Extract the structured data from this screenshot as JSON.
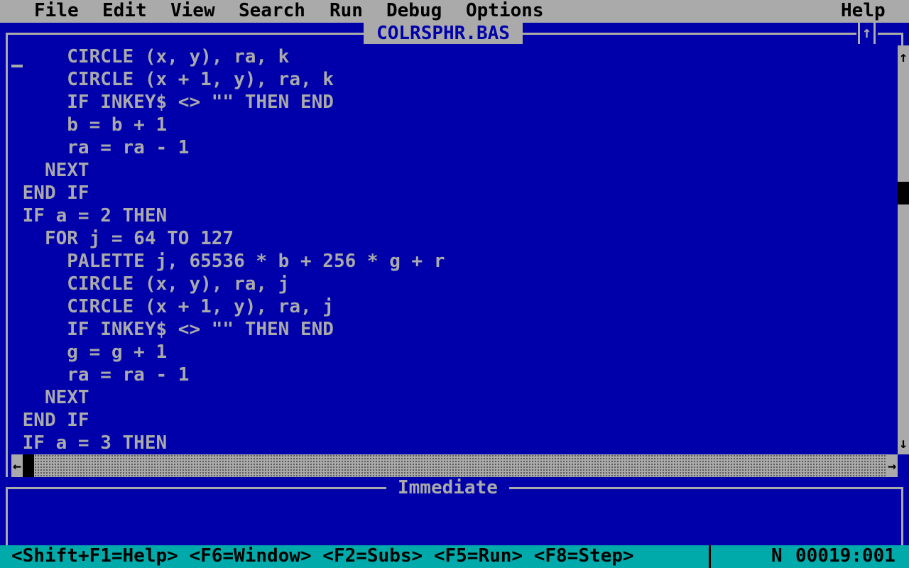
{
  "menu": {
    "file": "File",
    "edit": "Edit",
    "view": "View",
    "search": "Search",
    "run": "Run",
    "debug": "Debug",
    "options": "Options",
    "help": "Help"
  },
  "editor": {
    "title": "COLRSPHR.BAS",
    "maximize_icon": "↑",
    "lines": [
      "     CIRCLE (x, y), ra, k",
      "     CIRCLE (x + 1, y), ra, k",
      "     IF INKEY$ <> \"\" THEN END",
      "     b = b + 1",
      "     ra = ra - 1",
      "   NEXT",
      " END IF",
      " IF a = 2 THEN",
      "   FOR j = 64 TO 127",
      "     PALETTE j, 65536 * b + 256 * g + r",
      "     CIRCLE (x, y), ra, j",
      "     CIRCLE (x + 1, y), ra, j",
      "     IF INKEY$ <> \"\" THEN END",
      "     g = g + 1",
      "     ra = ra - 1",
      "   NEXT",
      " END IF",
      " IF a = 3 THEN"
    ],
    "scroll_up_icon": "↑",
    "scroll_down_icon": "↓",
    "scroll_left_icon": "←",
    "scroll_right_icon": "→"
  },
  "immediate": {
    "title": "Immediate"
  },
  "status": {
    "hints": "<Shift+F1=Help> <F6=Window> <F2=Subs> <F5=Run> <F8=Step>",
    "mode": "N",
    "position": "00019:001"
  },
  "colors": {
    "background": "#0000aa",
    "text": "#aaaaaa",
    "menu_bg": "#aaaaaa",
    "status_bg": "#00aaaa"
  }
}
